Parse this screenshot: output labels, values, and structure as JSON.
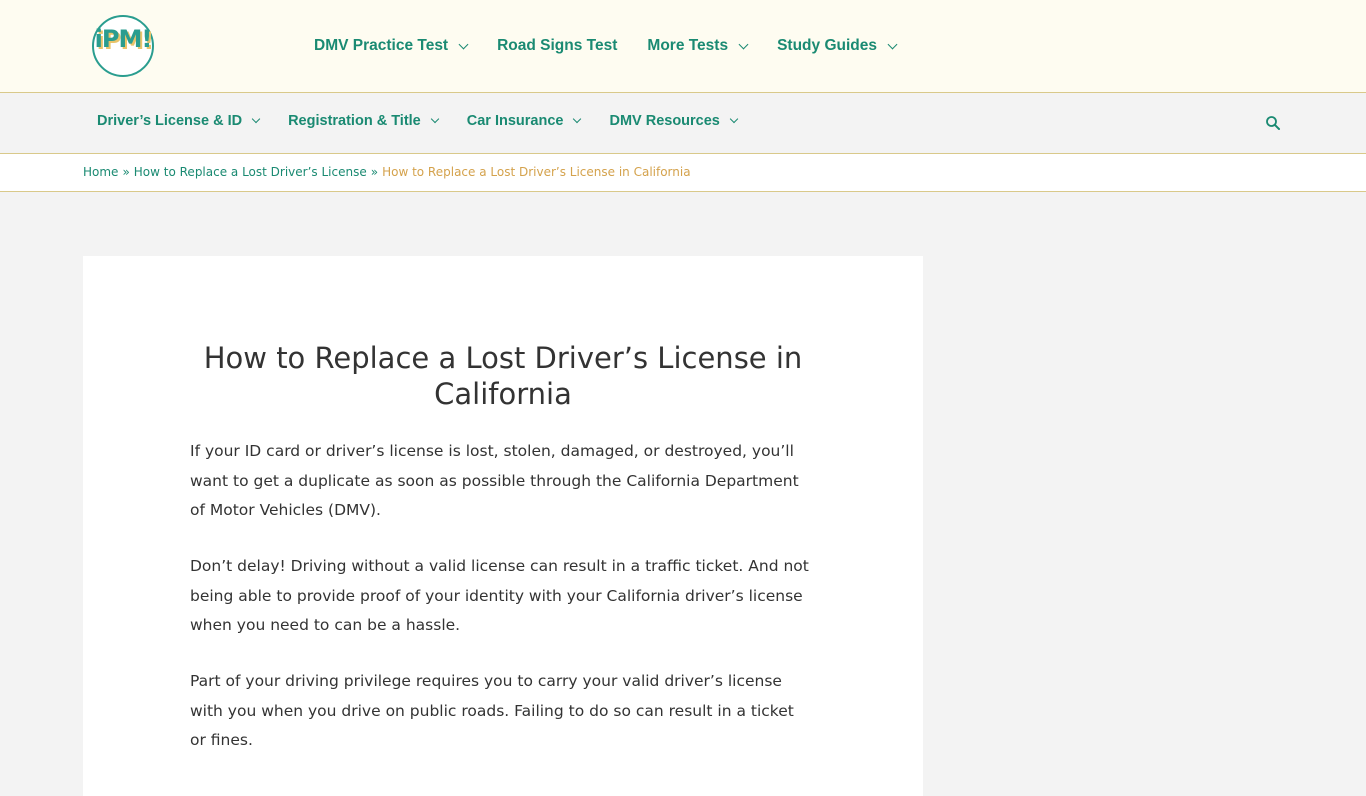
{
  "header": {
    "logo_text": "iPM!",
    "nav": [
      {
        "label": "DMV Practice Test",
        "has_dropdown": true
      },
      {
        "label": "Road Signs Test",
        "has_dropdown": false
      },
      {
        "label": "More Tests",
        "has_dropdown": true
      },
      {
        "label": "Study Guides",
        "has_dropdown": true
      }
    ]
  },
  "secondary_nav": {
    "items": [
      {
        "label": "Driver’s License & ID"
      },
      {
        "label": "Registration & Title"
      },
      {
        "label": "Car Insurance"
      },
      {
        "label": "DMV Resources"
      }
    ],
    "search_icon": "search-icon"
  },
  "breadcrumb": {
    "items": [
      "Home",
      "How to Replace a Lost Driver’s License"
    ],
    "current": "How to Replace a Lost Driver’s License in California",
    "separator": "»"
  },
  "article": {
    "title": "How to Replace a Lost Driver’s License in California",
    "paragraphs": [
      "If your ID card or driver’s license is lost, stolen, damaged, or destroyed, you’ll want to get a duplicate as soon as possible through the California Department of Motor Vehicles (DMV).",
      "Don’t delay! Driving without a valid license can result in a traffic ticket. And not being able to provide proof of your identity with your California driver’s license when you need to can be a hassle.",
      "Part of your driving privilege requires you to carry your valid driver’s license with you when you drive on public roads. Failing to do so can result in a ticket or fines."
    ]
  },
  "colors": {
    "accent": "#1a8a72",
    "breadcrumb_current": "#d4a24c",
    "header_bg": "#fefcf1",
    "border": "#d9c98a"
  }
}
